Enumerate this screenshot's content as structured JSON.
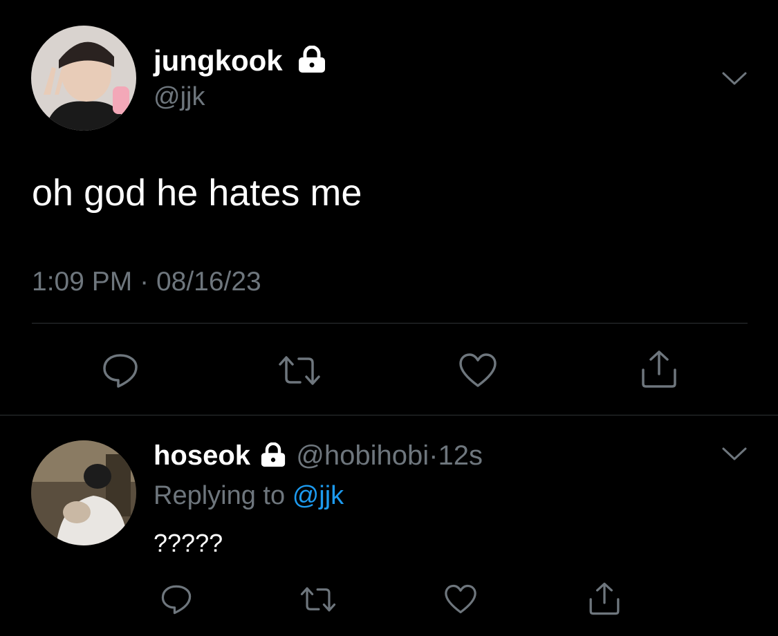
{
  "main_tweet": {
    "display_name": "jungkook",
    "handle": "@jjk",
    "text": "oh god he hates me",
    "time": "1:09 PM",
    "separator": "·",
    "date": "08/16/23",
    "avatar_icon": "avatar-photo",
    "lock_icon": "lock-icon",
    "menu_icon": "chevron-down-icon"
  },
  "actions": [
    "reply-icon",
    "retweet-icon",
    "like-icon",
    "share-icon"
  ],
  "reply_tweet": {
    "display_name": "hoseok",
    "handle": "@hobihobi",
    "separator": "·",
    "time_ago": "12s",
    "replying_to_label": "Replying to",
    "replying_to_handle": "@jjk",
    "text": "?????"
  },
  "colors": {
    "background": "#000000",
    "text": "#ffffff",
    "secondary": "#6e767d",
    "link": "#1d9bf0",
    "divider": "#2f3336"
  }
}
